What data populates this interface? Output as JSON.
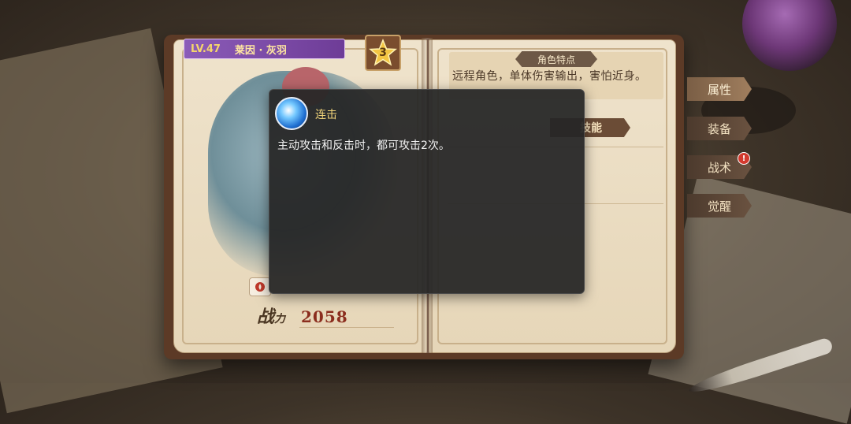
{
  "character": {
    "level": "LV.47",
    "name": "莱因 · 灰羽",
    "star": "3"
  },
  "power": {
    "label_main": "战",
    "label_sub": "力",
    "value": "2058"
  },
  "traits": {
    "section_title": "角色特点",
    "text": "远程角色，单体伤害输出，害怕近身。",
    "skills_tab": "技能"
  },
  "side_tabs": [
    {
      "label": "属性",
      "active": true
    },
    {
      "label": "装备"
    },
    {
      "label": "战术",
      "alert": "!"
    },
    {
      "label": "觉醒"
    }
  ],
  "tooltip": {
    "icon": "combo-skill-icon",
    "title": "连击",
    "description": "主动攻击和反击时，都可攻击2次。"
  }
}
